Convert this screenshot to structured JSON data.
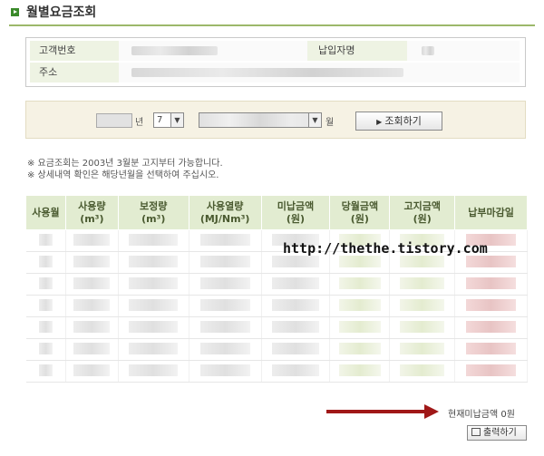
{
  "page": {
    "title": "월별요금조회",
    "watermark": "http://thethe.tistory.com"
  },
  "info": {
    "customer_no_label": "고객번호",
    "payer_label": "납입자명",
    "address_label": "주소"
  },
  "search": {
    "year_unit": "년",
    "month_value": "7",
    "month_unit": "월",
    "button_label": "조회하기"
  },
  "notes": [
    "※ 요금조회는 2003년 3월분 고지부터 가능합니다.",
    "※ 상세내역 확인은 해당년월을 선택하여 주십시오."
  ],
  "table": {
    "headers": [
      {
        "line1": "사용월",
        "line2": ""
      },
      {
        "line1": "사용량",
        "line2": "(m³)"
      },
      {
        "line1": "보정량",
        "line2": "(m³)"
      },
      {
        "line1": "사용열량",
        "line2": "(MJ/Nm³)"
      },
      {
        "line1": "미납금액",
        "line2": "(원)"
      },
      {
        "line1": "당월금액",
        "line2": "(원)"
      },
      {
        "line1": "고지금액",
        "line2": "(원)"
      },
      {
        "line1": "납부마감일",
        "line2": ""
      }
    ],
    "row_count": 7
  },
  "footer": {
    "unpaid_text": "현재미납금액 0원",
    "print_label": "출력하기"
  },
  "colors": {
    "accent": "#3a8a2a",
    "header_bg": "#e2ecd1",
    "arrow": "#a01818"
  }
}
